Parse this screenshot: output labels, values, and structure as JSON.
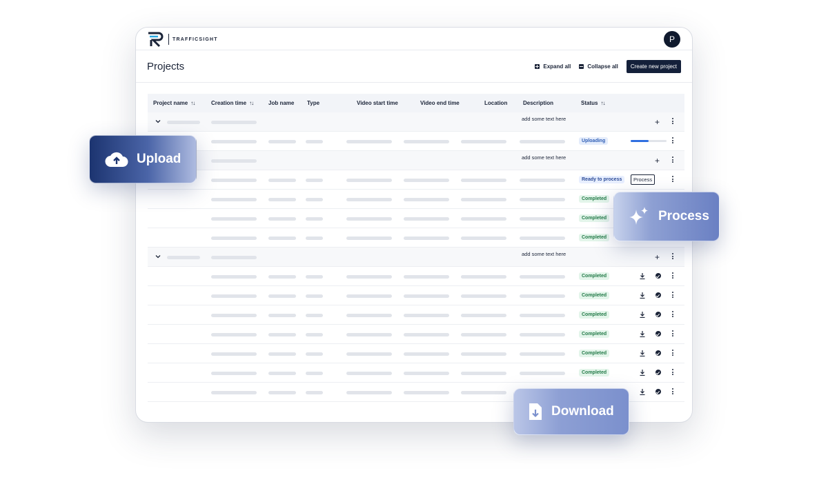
{
  "brand": {
    "name": "TRAFFICSIGHT"
  },
  "user": {
    "avatar_initial": "P"
  },
  "header": {
    "title": "Projects",
    "expand_all": "Expand all",
    "collapse_all": "Collapse all",
    "create_new": "Create new project"
  },
  "table": {
    "columns": {
      "project_name": "Project name",
      "creation_time": "Creation time",
      "job_name": "Job name",
      "type": "Type",
      "video_start": "Video start time",
      "video_end": "Video end time",
      "location": "Location",
      "description": "Description",
      "status": "Status"
    },
    "group_description": "add some text here",
    "status": {
      "uploading": "Uploading",
      "ready": "Ready to process",
      "completed": "Completed"
    },
    "process_button": "Process"
  },
  "overlays": {
    "upload": "Upload",
    "process": "Process",
    "download": "Download"
  },
  "colors": {
    "primary": "#14203a",
    "accent_blue": "#2f6fe0",
    "completed": "#237a48"
  }
}
